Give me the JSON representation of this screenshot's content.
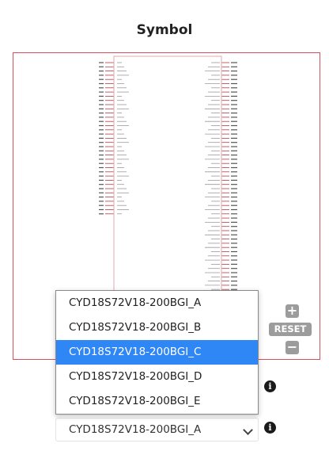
{
  "page": {
    "title": "Symbol"
  },
  "viewer": {
    "border_color": "#d7515b",
    "pin_color": "#b53a45",
    "controls": {
      "zoom_in_icon": "plus-icon",
      "zoom_out_icon": "minus-icon",
      "reset_label": "RESET"
    }
  },
  "part_select": {
    "options": [
      "CYD18S72V18-200BGI_A",
      "CYD18S72V18-200BGI_B",
      "CYD18S72V18-200BGI_C",
      "CYD18S72V18-200BGI_D",
      "CYD18S72V18-200BGI_E"
    ],
    "highlighted_index": 2,
    "highlight_color": "#2f86f5",
    "value": "CYD18S72V18-200BGI_A"
  },
  "info_icons": [
    "info-icon",
    "info-icon"
  ]
}
